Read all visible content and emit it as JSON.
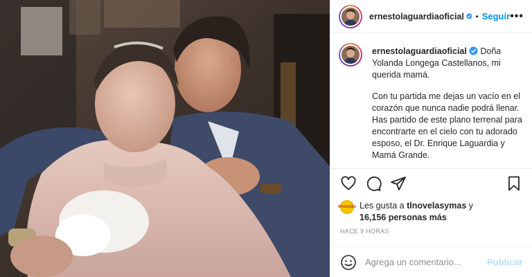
{
  "post": {
    "username": "ernestolaguardiaoficial",
    "follow_label": "Seguir",
    "separator": "•",
    "more_label": "•••",
    "caption": {
      "username": "ernestolaguardiaoficial",
      "first_text": "Doña Yolanda Longega Castellanos, mi querida mamá.",
      "second_paragraph": "Con tu partida me dejas un vacío en el corazón que nunca nadie podrá llenar. Has partido de este plano terrenal para encontrarte en el cielo con tu adorado esposo, el Dr. Enrique Laguardia y Mamá Grande."
    },
    "likes": {
      "prefix": "Les gusta a",
      "liker": "tlnovelasymas",
      "conjunction": "y",
      "count_text": "16,156 personas más",
      "liker_badge": "tlnovelas"
    },
    "timestamp": "HACE 9 HORAS",
    "comment": {
      "placeholder": "Agrega un comentario...",
      "publish_label": "Publicar"
    }
  },
  "icons": {
    "header_verified": "verified-badge-icon",
    "like": "heart-icon",
    "comment": "comment-icon",
    "share": "paper-plane-icon",
    "save": "bookmark-icon",
    "emoji": "smiley-icon"
  },
  "colors": {
    "link_blue": "#0095f6",
    "publish_disabled": "#b2dffc",
    "text": "#262626",
    "muted": "#8e8e8e",
    "divider": "#efefef"
  }
}
